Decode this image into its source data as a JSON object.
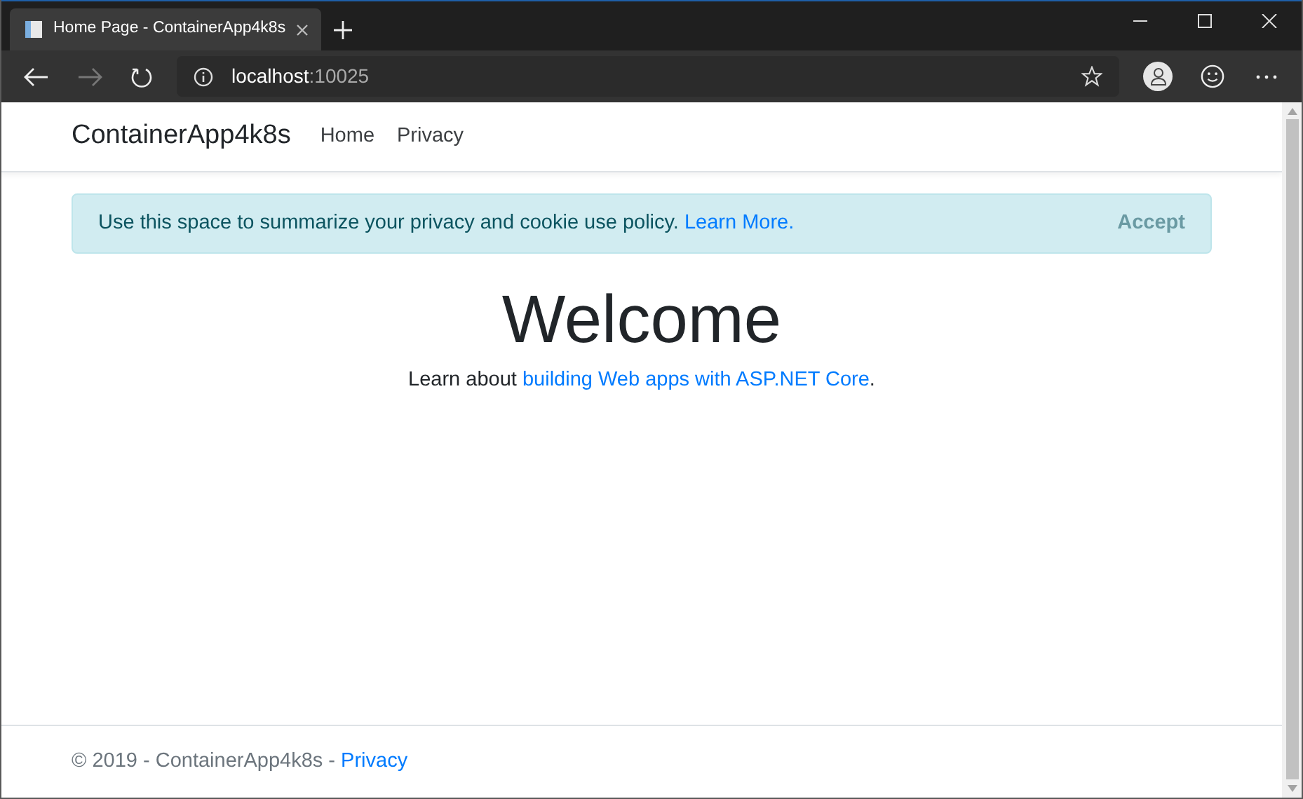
{
  "browser": {
    "tab": {
      "title": "Home Page - ContainerApp4k8s",
      "selected": true
    },
    "address": {
      "host": "localhost",
      "port": ":10025"
    },
    "forward_disabled": true
  },
  "navbar": {
    "brand": "ContainerApp4k8s",
    "links": [
      "Home",
      "Privacy"
    ]
  },
  "cookie_alert": {
    "message": "Use this space to summarize your privacy and cookie use policy.",
    "link": "Learn More.",
    "button": "Accept"
  },
  "main": {
    "heading": "Welcome",
    "lead": "Learn about ",
    "link": "building Web apps with ASP.NET Core",
    "tail": "."
  },
  "footer": {
    "text": "© 2019 - ContainerApp4k8s - ",
    "link": "Privacy"
  }
}
